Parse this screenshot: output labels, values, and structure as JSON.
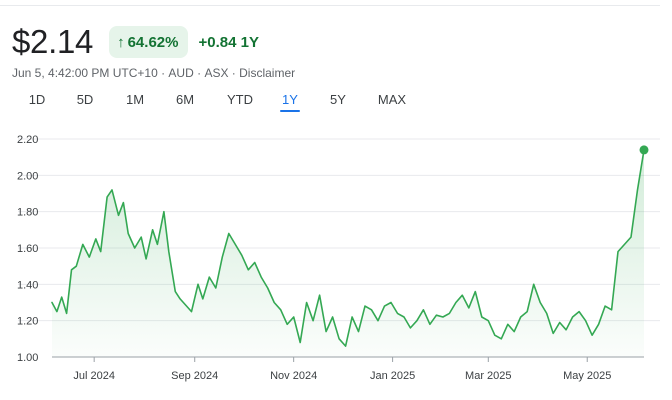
{
  "quote": {
    "price": "$2.14",
    "percent_change": "64.62%",
    "change_icon": "arrow-up-icon",
    "absolute_change": "+0.84",
    "change_period": "1Y"
  },
  "meta": {
    "timestamp": "Jun 5, 4:42:00 PM UTC+10",
    "currency": "AUD",
    "exchange": "ASX",
    "disclaimer": "Disclaimer"
  },
  "ranges": {
    "selected": "1Y",
    "items": [
      "1D",
      "5D",
      "1M",
      "6M",
      "YTD",
      "1Y",
      "5Y",
      "MAX"
    ]
  },
  "colors": {
    "positive": "#137333",
    "line": "#34a853",
    "positive_bg": "#e6f4ea",
    "accent": "#1a73e8"
  },
  "chart_data": {
    "type": "area",
    "y_ticks": [
      "1.00",
      "1.20",
      "1.40",
      "1.60",
      "1.80",
      "2.00",
      "2.20"
    ],
    "ylim": [
      1.0,
      2.2
    ],
    "x_ticks": [
      {
        "label": "Jul 2024",
        "date": "2024-07-01"
      },
      {
        "label": "Sep 2024",
        "date": "2024-09-01"
      },
      {
        "label": "Nov 2024",
        "date": "2024-11-01"
      },
      {
        "label": "Jan 2025",
        "date": "2025-01-01"
      },
      {
        "label": "Mar 2025",
        "date": "2025-03-01"
      },
      {
        "label": "May 2025",
        "date": "2025-05-01"
      }
    ],
    "xlim": [
      "2024-06-05",
      "2025-06-05"
    ],
    "grid": true,
    "series": [
      {
        "x": [
          "2024-06-05",
          "2024-06-08",
          "2024-06-11",
          "2024-06-14",
          "2024-06-17",
          "2024-06-20",
          "2024-06-24",
          "2024-06-28",
          "2024-07-02",
          "2024-07-05",
          "2024-07-09",
          "2024-07-12",
          "2024-07-16",
          "2024-07-19",
          "2024-07-22",
          "2024-07-26",
          "2024-07-30",
          "2024-08-02",
          "2024-08-06",
          "2024-08-09",
          "2024-08-13",
          "2024-08-16",
          "2024-08-20",
          "2024-08-23",
          "2024-08-27",
          "2024-08-30",
          "2024-09-03",
          "2024-09-06",
          "2024-09-10",
          "2024-09-14",
          "2024-09-18",
          "2024-09-22",
          "2024-09-26",
          "2024-09-30",
          "2024-10-04",
          "2024-10-08",
          "2024-10-12",
          "2024-10-16",
          "2024-10-20",
          "2024-10-24",
          "2024-10-28",
          "2024-11-01",
          "2024-11-05",
          "2024-11-09",
          "2024-11-13",
          "2024-11-17",
          "2024-11-21",
          "2024-11-25",
          "2024-11-29",
          "2024-12-03",
          "2024-12-07",
          "2024-12-11",
          "2024-12-15",
          "2024-12-19",
          "2024-12-23",
          "2024-12-27",
          "2024-12-31",
          "2025-01-04",
          "2025-01-08",
          "2025-01-12",
          "2025-01-16",
          "2025-01-20",
          "2025-01-24",
          "2025-01-28",
          "2025-02-01",
          "2025-02-05",
          "2025-02-09",
          "2025-02-13",
          "2025-02-17",
          "2025-02-21",
          "2025-02-25",
          "2025-03-01",
          "2025-03-05",
          "2025-03-09",
          "2025-03-13",
          "2025-03-17",
          "2025-03-21",
          "2025-03-25",
          "2025-03-29",
          "2025-04-02",
          "2025-04-06",
          "2025-04-10",
          "2025-04-14",
          "2025-04-18",
          "2025-04-22",
          "2025-04-26",
          "2025-04-30",
          "2025-05-04",
          "2025-05-08",
          "2025-05-12",
          "2025-05-16",
          "2025-05-20",
          "2025-05-24",
          "2025-05-28",
          "2025-06-01",
          "2025-06-05"
        ],
        "y": [
          1.3,
          1.25,
          1.33,
          1.24,
          1.48,
          1.5,
          1.62,
          1.55,
          1.65,
          1.58,
          1.88,
          1.92,
          1.78,
          1.85,
          1.68,
          1.6,
          1.66,
          1.54,
          1.7,
          1.62,
          1.8,
          1.58,
          1.36,
          1.32,
          1.28,
          1.25,
          1.4,
          1.32,
          1.44,
          1.38,
          1.55,
          1.68,
          1.62,
          1.56,
          1.48,
          1.52,
          1.44,
          1.38,
          1.3,
          1.26,
          1.18,
          1.22,
          1.08,
          1.3,
          1.2,
          1.34,
          1.14,
          1.22,
          1.1,
          1.06,
          1.22,
          1.14,
          1.28,
          1.26,
          1.2,
          1.28,
          1.3,
          1.24,
          1.22,
          1.16,
          1.2,
          1.26,
          1.18,
          1.23,
          1.22,
          1.24,
          1.3,
          1.34,
          1.27,
          1.36,
          1.22,
          1.2,
          1.12,
          1.1,
          1.18,
          1.14,
          1.22,
          1.25,
          1.4,
          1.3,
          1.24,
          1.13,
          1.19,
          1.15,
          1.22,
          1.25,
          1.2,
          1.12,
          1.18,
          1.28,
          1.26,
          1.58,
          1.62,
          1.66,
          1.92,
          2.14
        ]
      }
    ]
  }
}
